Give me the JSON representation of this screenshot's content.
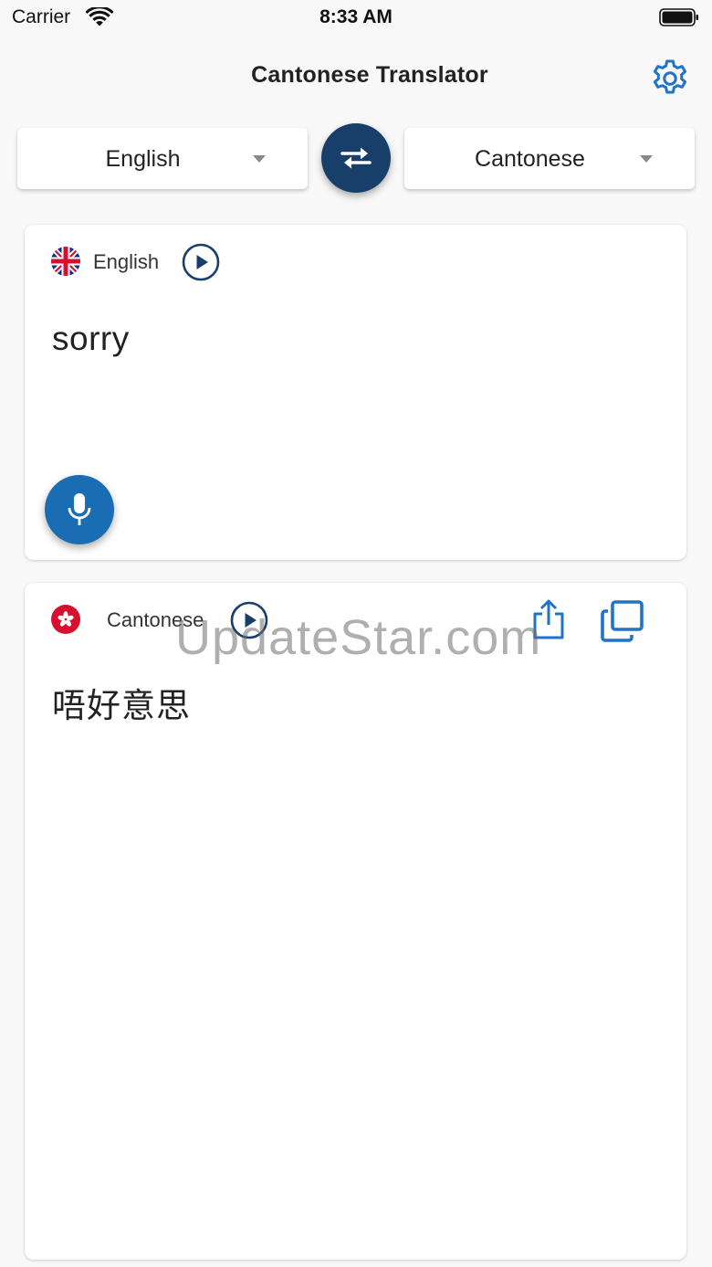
{
  "status_bar": {
    "carrier": "Carrier",
    "time": "8:33 AM",
    "icons": [
      "wifi-icon",
      "battery-icon"
    ]
  },
  "nav": {
    "title": "Cantonese Translator",
    "settings_icon": "gear-icon"
  },
  "language_bar": {
    "source_language": "English",
    "target_language": "Cantonese",
    "swap_icon": "swap-arrows-icon"
  },
  "source_card": {
    "language": "English",
    "flag_icon": "uk-flag-icon",
    "play_icon": "play-icon",
    "text": "sorry",
    "mic_icon": "microphone-icon"
  },
  "target_card": {
    "language": "Cantonese",
    "flag_icon": "hong-kong-flag-icon",
    "play_icon": "play-icon",
    "share_icon": "share-icon",
    "copy_icon": "copy-icon",
    "text": "唔好意思"
  },
  "watermark": "UpdateStar.com",
  "colors": {
    "primary_dark": "#173f6a",
    "primary": "#1b6db3",
    "icon_blue": "#1f73c9",
    "background": "#f8f8f8",
    "flag_red": "#d8102f"
  }
}
